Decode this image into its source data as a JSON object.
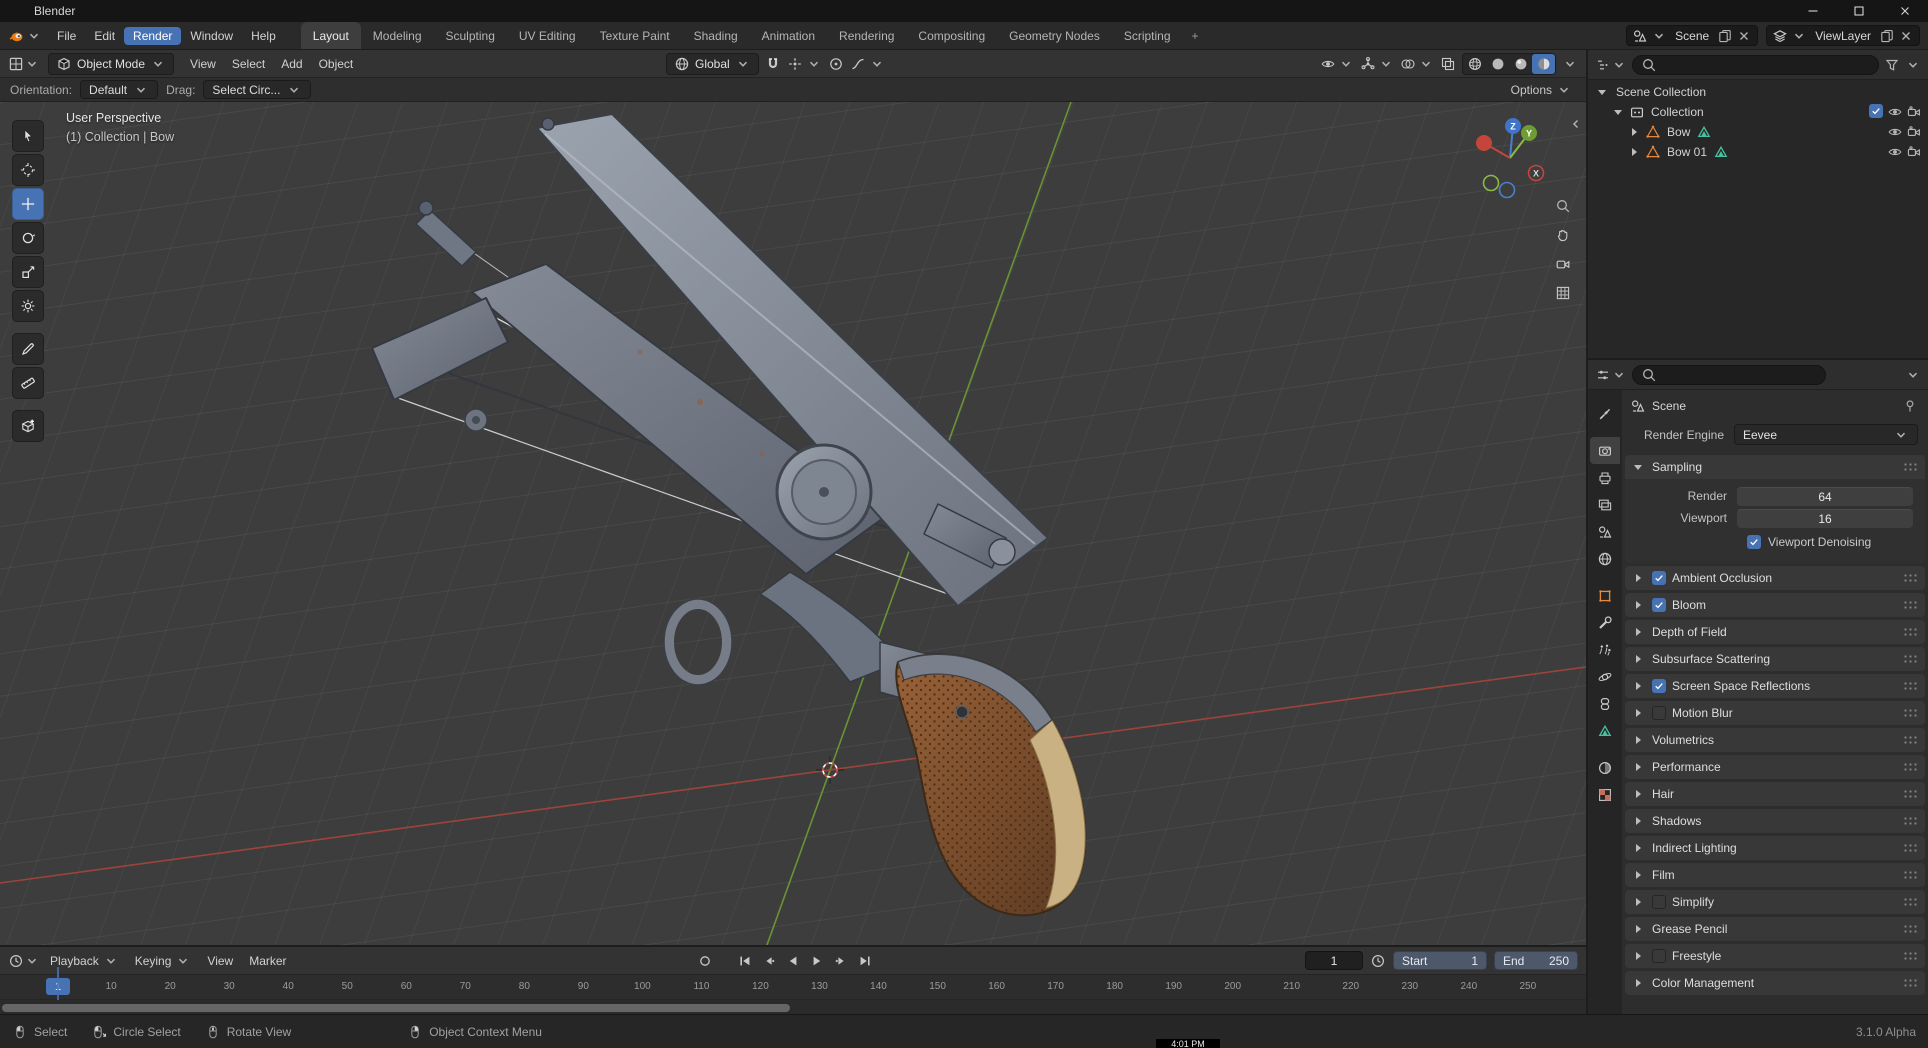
{
  "colors": {
    "accent": "#4772b3",
    "object_orange": "#e8883a",
    "data_green": "#47c2a0",
    "axis_x": "#a8453a",
    "axis_y": "#6f9c33",
    "viewport_bg": "#3d3d3d"
  },
  "titlebar": {
    "title": "Blender"
  },
  "topbar": {
    "menus": [
      "File",
      "Edit",
      "Render",
      "Window",
      "Help"
    ],
    "active_menu": "Render",
    "tabs": [
      "Layout",
      "Modeling",
      "Sculpting",
      "UV Editing",
      "Texture Paint",
      "Shading",
      "Animation",
      "Rendering",
      "Compositing",
      "Geometry Nodes",
      "Scripting"
    ],
    "active_tab": "Layout",
    "add_tab_label": "+",
    "scene_value": "Scene",
    "viewlayer_value": "ViewLayer"
  },
  "viewport_header": {
    "mode": "Object Mode",
    "menus": [
      "View",
      "Select",
      "Add",
      "Object"
    ],
    "orientation": "Global",
    "shading_modes": [
      "wireframe",
      "solid",
      "material-preview",
      "rendered"
    ],
    "active_shading": "rendered"
  },
  "tool_settings": {
    "orientation_label": "Orientation:",
    "orientation_value": "Default",
    "drag_label": "Drag:",
    "drag_value": "Select Circ...",
    "options_label": "Options"
  },
  "viewport": {
    "overlay_line1": "User Perspective",
    "overlay_line2": "(1) Collection | Bow",
    "tools": [
      "tweak-select",
      "cursor",
      "move",
      "rotate",
      "scale",
      "transform",
      "annotate",
      "measure",
      "add-cube"
    ],
    "active_tool": "move",
    "gizmo_axes": {
      "x": "X",
      "y": "Y",
      "z": "Z"
    }
  },
  "outliner": {
    "rows": [
      {
        "label": "Scene Collection",
        "depth": 0,
        "disclosure": "down",
        "icon": null,
        "badge": null,
        "checkbox": false,
        "toggles": []
      },
      {
        "label": "Collection",
        "depth": 1,
        "disclosure": "down",
        "icon": "collection",
        "badge": null,
        "checkbox": true,
        "toggles": [
          "eye",
          "camera"
        ]
      },
      {
        "label": "Bow",
        "depth": 2,
        "disclosure": "right",
        "icon": "mesh",
        "badge": "data",
        "checkbox": false,
        "toggles": [
          "eye",
          "camera"
        ]
      },
      {
        "label": "Bow 01",
        "depth": 2,
        "disclosure": "right",
        "icon": "mesh",
        "badge": "data",
        "checkbox": false,
        "toggles": [
          "eye",
          "camera"
        ]
      }
    ]
  },
  "properties": {
    "breadcrumb": "Scene",
    "engine_label": "Render Engine",
    "engine_value": "Eevee",
    "sampling": {
      "title": "Sampling",
      "rows": [
        {
          "label": "Render",
          "value": "64"
        },
        {
          "label": "Viewport",
          "value": "16"
        }
      ],
      "checkbox": {
        "label": "Viewport Denoising",
        "checked": true
      }
    },
    "sections": [
      {
        "label": "Ambient Occlusion",
        "checkbox": "checked"
      },
      {
        "label": "Bloom",
        "checkbox": "checked"
      },
      {
        "label": "Depth of Field",
        "checkbox": "none"
      },
      {
        "label": "Subsurface Scattering",
        "checkbox": "none"
      },
      {
        "label": "Screen Space Reflections",
        "checkbox": "checked"
      },
      {
        "label": "Motion Blur",
        "checkbox": "unchecked"
      },
      {
        "label": "Volumetrics",
        "checkbox": "none"
      },
      {
        "label": "Performance",
        "checkbox": "none"
      },
      {
        "label": "Hair",
        "checkbox": "none"
      },
      {
        "label": "Shadows",
        "checkbox": "none"
      },
      {
        "label": "Indirect Lighting",
        "checkbox": "none"
      },
      {
        "label": "Film",
        "checkbox": "none"
      },
      {
        "label": "Simplify",
        "checkbox": "unchecked"
      },
      {
        "label": "Grease Pencil",
        "checkbox": "none"
      },
      {
        "label": "Freestyle",
        "checkbox": "unchecked"
      },
      {
        "label": "Color Management",
        "checkbox": "none"
      }
    ],
    "tab_groups": [
      [
        "tool"
      ],
      [
        "render",
        "output",
        "view-layer",
        "scene",
        "world"
      ],
      [
        "object",
        "modifiers",
        "particles",
        "physics",
        "constraints",
        "object-data"
      ],
      [
        "material",
        "texture"
      ]
    ],
    "active_tab": "render"
  },
  "timeline": {
    "menus": [
      "Playback",
      "Keying",
      "View",
      "Marker"
    ],
    "transport": [
      "jump-start",
      "prev-keyframe",
      "play-reverse",
      "play",
      "next-keyframe",
      "jump-end"
    ],
    "current_frame": "1",
    "start_label": "Start",
    "start_value": "1",
    "end_label": "End",
    "end_value": "250",
    "playhead_frame": "1",
    "ruler_frames": [
      10,
      20,
      30,
      40,
      50,
      60,
      70,
      80,
      90,
      100,
      110,
      120,
      130,
      140,
      150,
      160,
      170,
      180,
      190,
      200,
      210,
      220,
      230,
      240,
      250
    ]
  },
  "statusbar": {
    "items": [
      {
        "icon": "mouse-left",
        "label": "Select"
      },
      {
        "icon": "mouse-drag",
        "label": "Circle Select"
      },
      {
        "icon": "mouse-middle",
        "label": "Rotate View"
      },
      {
        "icon": "mouse-right",
        "label": "Object Context Menu"
      }
    ],
    "version": "3.1.0 Alpha"
  },
  "taskbar": {
    "clock": "4:01 PM"
  }
}
